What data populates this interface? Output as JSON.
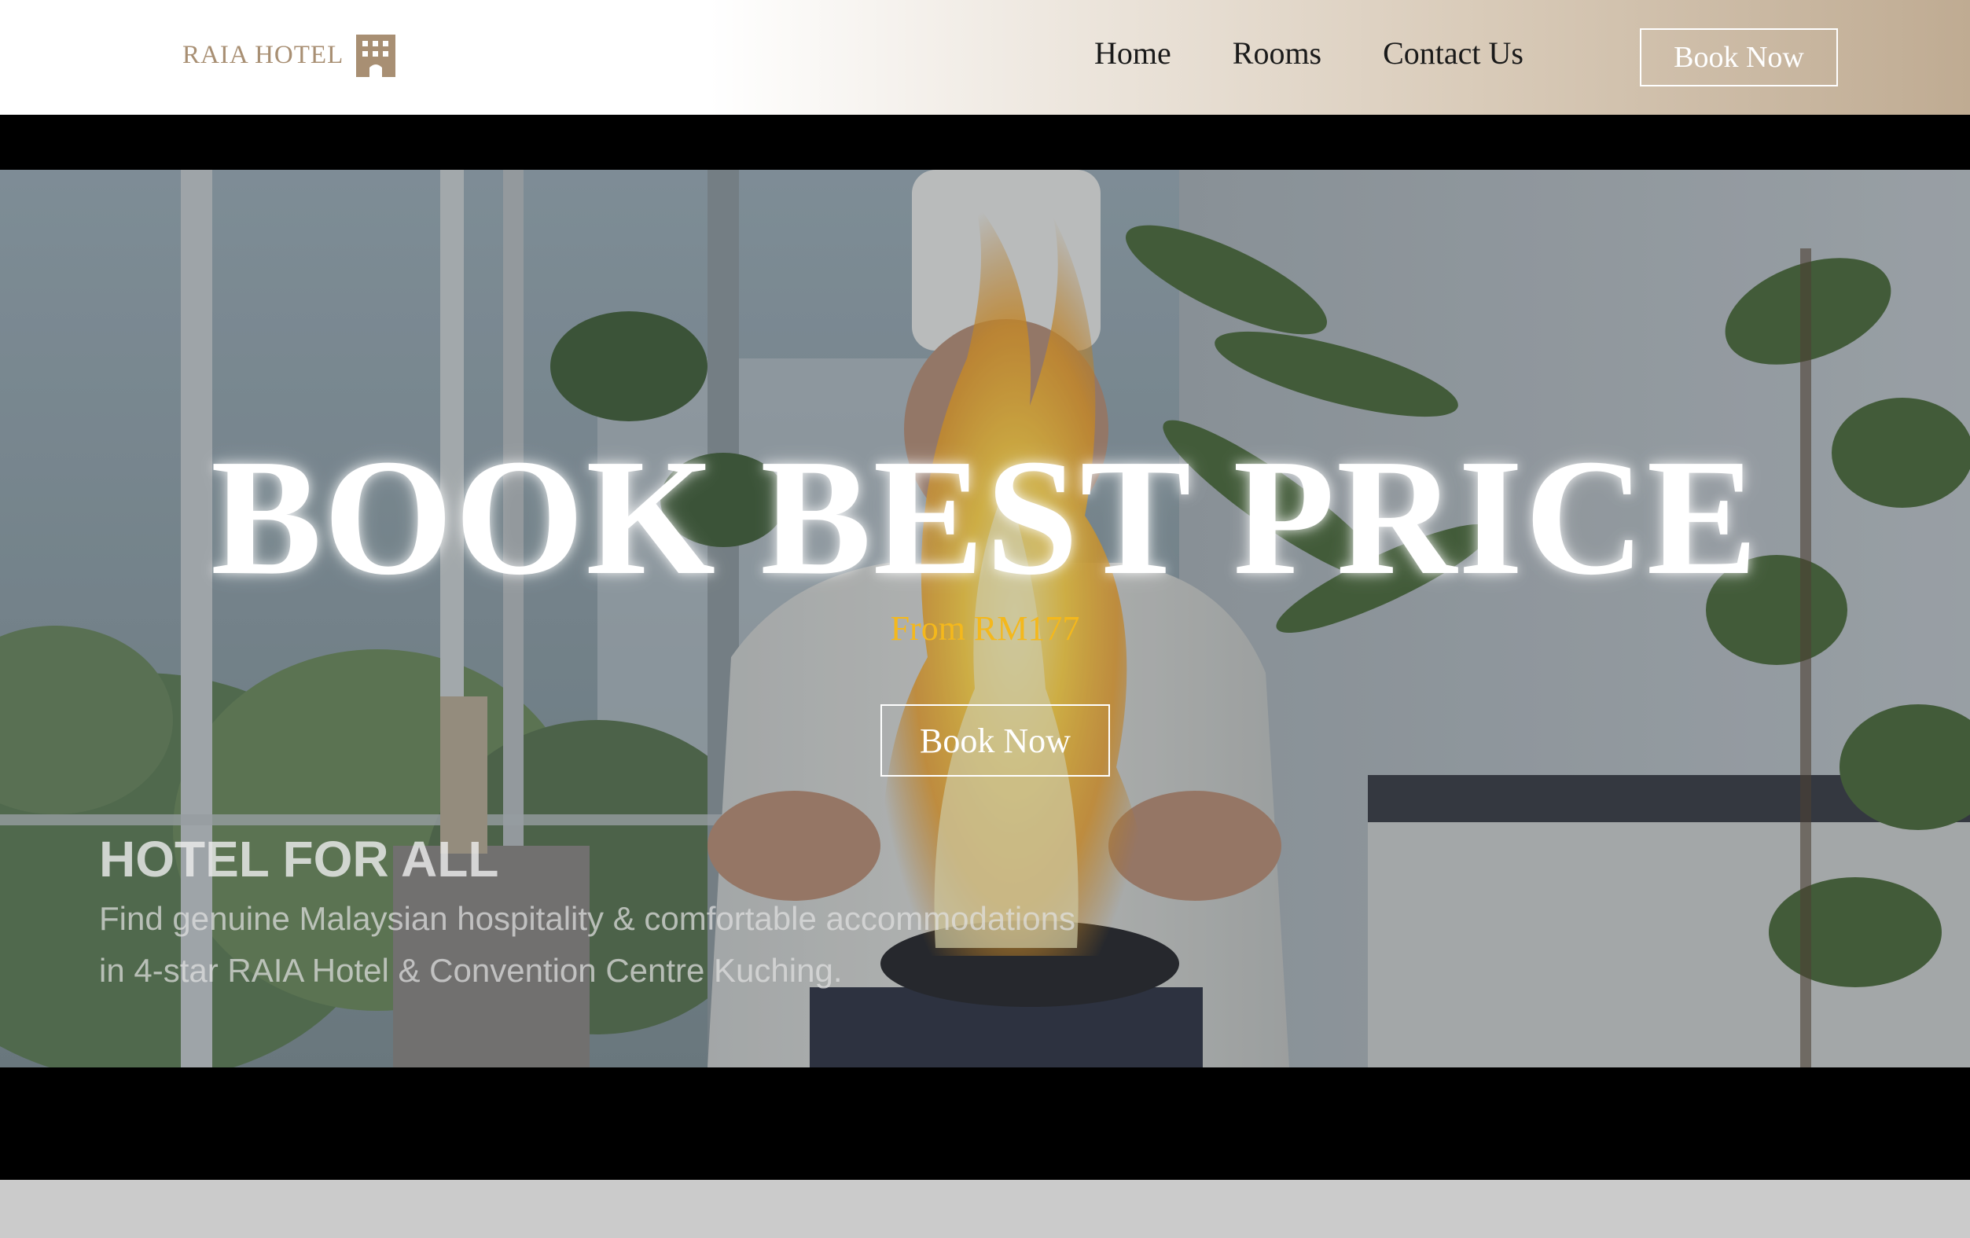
{
  "header": {
    "logo_text": "RAIA HOTEL",
    "logo_icon": "building-icon",
    "nav": [
      {
        "label": "Home"
      },
      {
        "label": "Rooms"
      },
      {
        "label": "Contact Us"
      }
    ],
    "book_label": "Book Now"
  },
  "hero": {
    "title": "BOOK BEST PRICE",
    "price": "From RM177",
    "book_label": "Book Now",
    "video_caption": {
      "title": "HOTEL FOR ALL",
      "line1": "Find genuine Malaysian hospitality & comfortable accommodations",
      "line2": "in 4-star RAIA Hotel & Convention Centre Kuching."
    }
  },
  "colors": {
    "logo": "#a88f73",
    "price_accent": "#f4b81c",
    "header_gradient_end": "#bfab92"
  }
}
